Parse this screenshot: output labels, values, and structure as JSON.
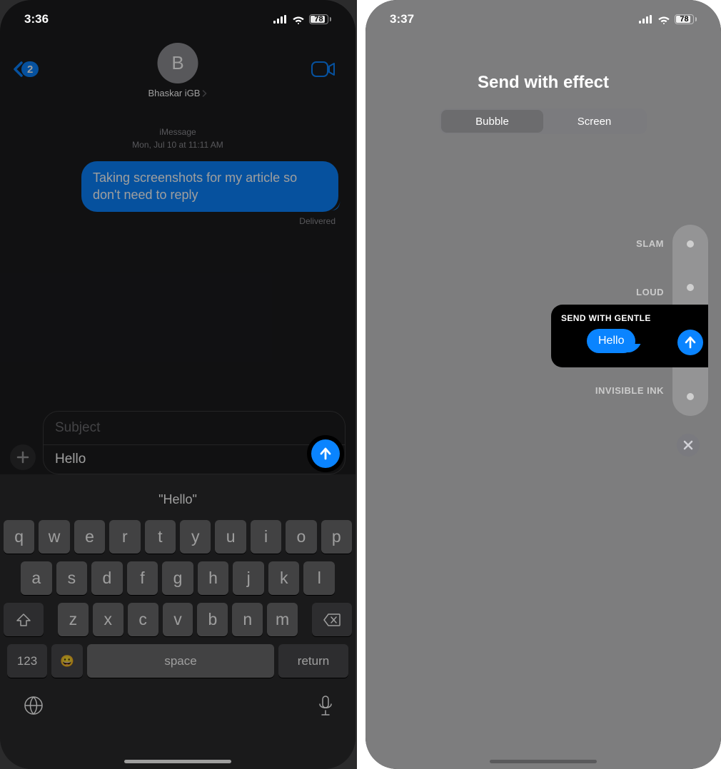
{
  "left": {
    "status": {
      "time": "3:36",
      "battery": "78"
    },
    "back_badge": "2",
    "contact": {
      "initial": "B",
      "name": "Bhaskar iGB"
    },
    "thread": {
      "service": "iMessage",
      "timestamp": "Mon, Jul 10 at 11:11 AM",
      "message": "Taking screenshots for my article so don't need to reply",
      "status": "Delivered"
    },
    "composer": {
      "subject_placeholder": "Subject",
      "message_value": "Hello"
    },
    "suggestion": "\"Hello\"",
    "keyboard": {
      "row1": [
        "q",
        "w",
        "e",
        "r",
        "t",
        "y",
        "u",
        "i",
        "o",
        "p"
      ],
      "row2": [
        "a",
        "s",
        "d",
        "f",
        "g",
        "h",
        "j",
        "k",
        "l"
      ],
      "row3": [
        "z",
        "x",
        "c",
        "v",
        "b",
        "n",
        "m"
      ],
      "bottom": {
        "numbers": "123",
        "space": "space",
        "return": "return"
      }
    }
  },
  "right": {
    "status": {
      "time": "3:37",
      "battery": "78"
    },
    "title": "Send with effect",
    "tabs": {
      "bubble": "Bubble",
      "screen": "Screen"
    },
    "effects": {
      "slam": "SLAM",
      "loud": "LOUD",
      "gentle_title": "SEND WITH GENTLE",
      "gentle_msg": "Hello",
      "invisible": "INVISIBLE INK"
    }
  }
}
